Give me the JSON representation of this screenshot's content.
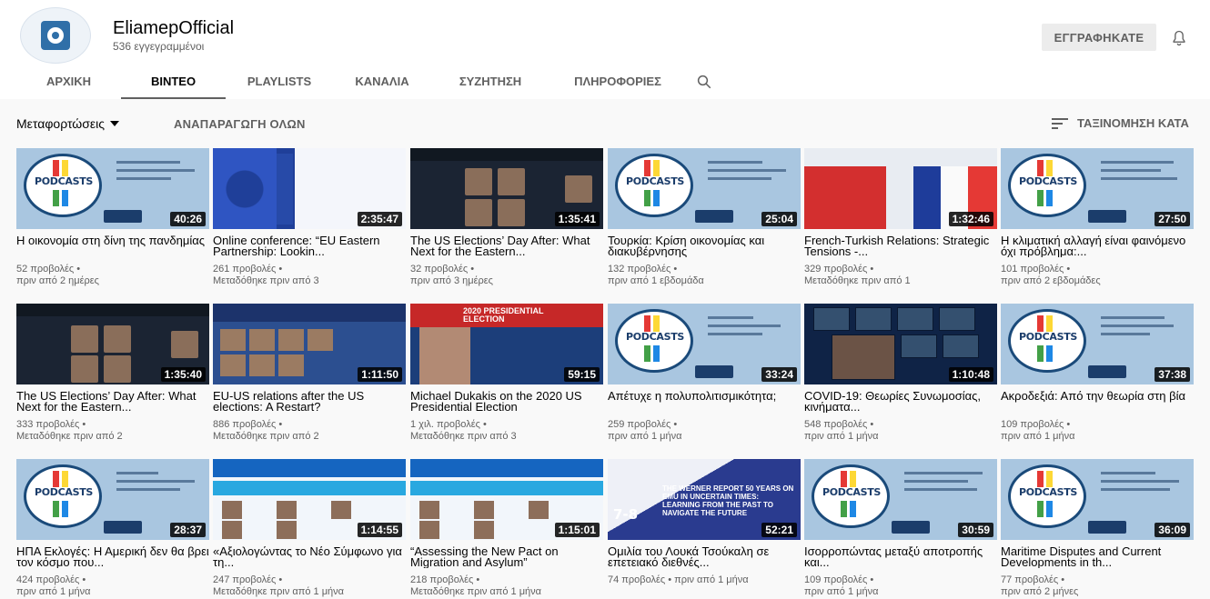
{
  "channel": {
    "name": "EliamepOfficial",
    "subscribers": "536 εγγεγραμμένοι",
    "subscribe_label": "ΕΓΓΡΑΦΗΚΑΤΕ"
  },
  "tabs": [
    {
      "label": "ΑΡΧΙΚΗ"
    },
    {
      "label": "ΒΙΝΤΕΟ"
    },
    {
      "label": "PLAYLISTS"
    },
    {
      "label": "ΚΑΝΑΛΙΑ"
    },
    {
      "label": "ΣΥΖΗΤΗΣΗ"
    },
    {
      "label": "ΠΛΗΡΟΦΟΡΙΕΣ"
    }
  ],
  "filters": {
    "uploads_label": "Μεταφορτώσεις",
    "play_all_label": "ΑΝΑΠΑΡΑΓΩΓΗ ΟΛΩΝ",
    "sort_label": "ΤΑΞΙΝΟΜΗΣΗ ΚΑΤΑ"
  },
  "thumb_text": {
    "podcasts": "PODCASTS",
    "werner_number": "7-8",
    "werner_title": "THE WERNER REPORT 50 YEARS ON EMU IN UNCERTAIN TIMES: LEARNING FROM THE PAST TO NAVIGATE THE FUTURE",
    "election_heading": "2020 PRESIDENTIAL ELECTION"
  },
  "videos": [
    {
      "title": "Η οικονομία στη δίνη της πανδημίας",
      "views": "52 προβολές •",
      "age": "πριν από 2 ημέρες",
      "duration": "40:26"
    },
    {
      "title": "Online conference: “EU Eastern Partnership: Lookin...",
      "views": "261 προβολές •",
      "age": "Μεταδόθηκε πριν από 3",
      "duration": "2:35:47"
    },
    {
      "title": "The US Elections’ Day After: What Next for the Eastern...",
      "views": "32 προβολές •",
      "age": "πριν από 3 ημέρες",
      "duration": "1:35:41"
    },
    {
      "title": "Τουρκία: Κρίση οικονομίας και διακυβέρνησης",
      "views": "132 προβολές •",
      "age": "πριν από 1 εβδομάδα",
      "duration": "25:04"
    },
    {
      "title": "French-Turkish Relations: Strategic Tensions -...",
      "views": "329 προβολές •",
      "age": "Μεταδόθηκε πριν από 1",
      "duration": "1:32:46"
    },
    {
      "title": "Η κλιματική αλλαγή είναι φαινόμενο όχι πρόβλημα:...",
      "views": "101 προβολές •",
      "age": "πριν από 2 εβδομάδες",
      "duration": "27:50"
    },
    {
      "title": "The US Elections’ Day After: What Next for the Eastern...",
      "views": "333 προβολές •",
      "age": "Μεταδόθηκε πριν από 2",
      "duration": "1:35:40"
    },
    {
      "title": "EU-US relations after the US elections: A Restart?",
      "views": "886 προβολές •",
      "age": "Μεταδόθηκε πριν από 2",
      "duration": "1:11:50"
    },
    {
      "title": "Michael Dukakis on the 2020 US Presidential Election",
      "views": "1 χιλ. προβολές •",
      "age": "Μεταδόθηκε πριν από 3",
      "duration": "59:15"
    },
    {
      "title": "Απέτυχε η πολυπολιτισμικότητα;",
      "views": "259 προβολές •",
      "age": "πριν από 1 μήνα",
      "duration": "33:24"
    },
    {
      "title": "COVID-19: Θεωρίες Συνωμοσίας, κινήματα...",
      "views": "548 προβολές •",
      "age": "πριν από 1 μήνα",
      "duration": "1:10:48"
    },
    {
      "title": "Ακροδεξιά: Από την θεωρία στη βία",
      "views": "109 προβολές •",
      "age": "πριν από 1 μήνα",
      "duration": "37:38"
    },
    {
      "title": "ΗΠΑ Εκλογές: Η Αμερική δεν θα βρει τον κόσμο που...",
      "views": "424 προβολές •",
      "age": "πριν από 1 μήνα",
      "duration": "28:37"
    },
    {
      "title": "«Αξιολογώντας το Νέο Σύμφωνο για τη...",
      "views": "247 προβολές •",
      "age": "Μεταδόθηκε πριν από 1 μήνα",
      "duration": "1:14:55"
    },
    {
      "title": "“Assessing the New Pact on Migration and Asylum”",
      "views": "218 προβολές •",
      "age": "Μεταδόθηκε πριν από 1 μήνα",
      "duration": "1:15:01"
    },
    {
      "title": "Ομιλία του Λουκά Τσούκαλη σε επετειακό διεθνές...",
      "views": "74 προβολές • πριν από 1 μήνα",
      "age": "",
      "duration": "52:21"
    },
    {
      "title": "Ισορροπώντας μεταξύ αποτροπής και...",
      "views": "109 προβολές •",
      "age": "πριν από 1 μήνα",
      "duration": "30:59"
    },
    {
      "title": "Maritime Disputes and Current Developments in th...",
      "views": "77 προβολές •",
      "age": "πριν από 2 μήνες",
      "duration": "36:09"
    }
  ],
  "colors": {
    "background": "#f9f9f9",
    "header": "#ffffff",
    "text_primary": "#030303",
    "text_secondary": "#606060"
  }
}
